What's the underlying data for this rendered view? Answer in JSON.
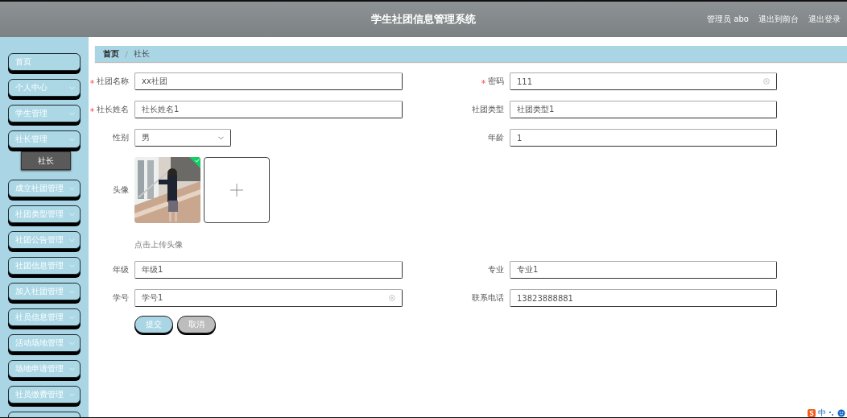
{
  "header": {
    "title": "学生社团信息管理系统",
    "user": "管理员 abo",
    "links": [
      "退出到前台",
      "退出登录"
    ]
  },
  "menu": [
    {
      "label": "首页",
      "expandable": false
    },
    {
      "label": "个人中心",
      "expandable": true
    },
    {
      "label": "学生管理",
      "expandable": true
    },
    {
      "label": "社长管理",
      "expandable": true,
      "children": [
        {
          "label": "社长",
          "selected": true
        }
      ]
    },
    {
      "label": "成立社团管理",
      "expandable": true
    },
    {
      "label": "社团类型管理",
      "expandable": true
    },
    {
      "label": "社团公告管理",
      "expandable": true
    },
    {
      "label": "社团信息管理",
      "expandable": true
    },
    {
      "label": "加入社团管理",
      "expandable": true
    },
    {
      "label": "社员信息管理",
      "expandable": true
    },
    {
      "label": "活动场地管理",
      "expandable": true
    },
    {
      "label": "场地申请管理",
      "expandable": true
    },
    {
      "label": "社员缴费管理",
      "expandable": true
    },
    {
      "kind": "partial"
    }
  ],
  "breadcrumb": [
    "首页",
    "社长"
  ],
  "form": {
    "rows": [
      [
        {
          "kind": "text",
          "label": "社团名称",
          "required": true,
          "value": "xx社团"
        },
        {
          "kind": "text",
          "label": "密码",
          "required": true,
          "value": "111",
          "clearable": true
        }
      ],
      [
        {
          "kind": "text",
          "label": "社长姓名",
          "required": true,
          "value": "社长姓名1"
        },
        {
          "kind": "text",
          "label": "社团类型",
          "required": false,
          "value": "社团类型1"
        }
      ],
      [
        {
          "kind": "select",
          "label": "性别",
          "required": false,
          "value": "男"
        },
        {
          "kind": "text",
          "label": "年龄",
          "required": false,
          "value": "1"
        }
      ],
      [
        {
          "kind": "upload",
          "label": "头像",
          "required": false,
          "uploaded": true,
          "hint": "点击上传头像"
        }
      ],
      [
        {
          "kind": "text",
          "label": "年级",
          "required": false,
          "value": "年级1"
        },
        {
          "kind": "text",
          "label": "专业",
          "required": false,
          "value": "专业1"
        }
      ],
      [
        {
          "kind": "text",
          "label": "学号",
          "required": false,
          "value": "学号1",
          "clearable": true
        },
        {
          "kind": "text",
          "label": "联系电话",
          "required": false,
          "value": "13823888881"
        }
      ]
    ],
    "buttons": [
      {
        "label": "提交",
        "kind": "primary"
      },
      {
        "label": "取消",
        "kind": "default"
      }
    ]
  },
  "ime": {
    "mode": "中"
  }
}
